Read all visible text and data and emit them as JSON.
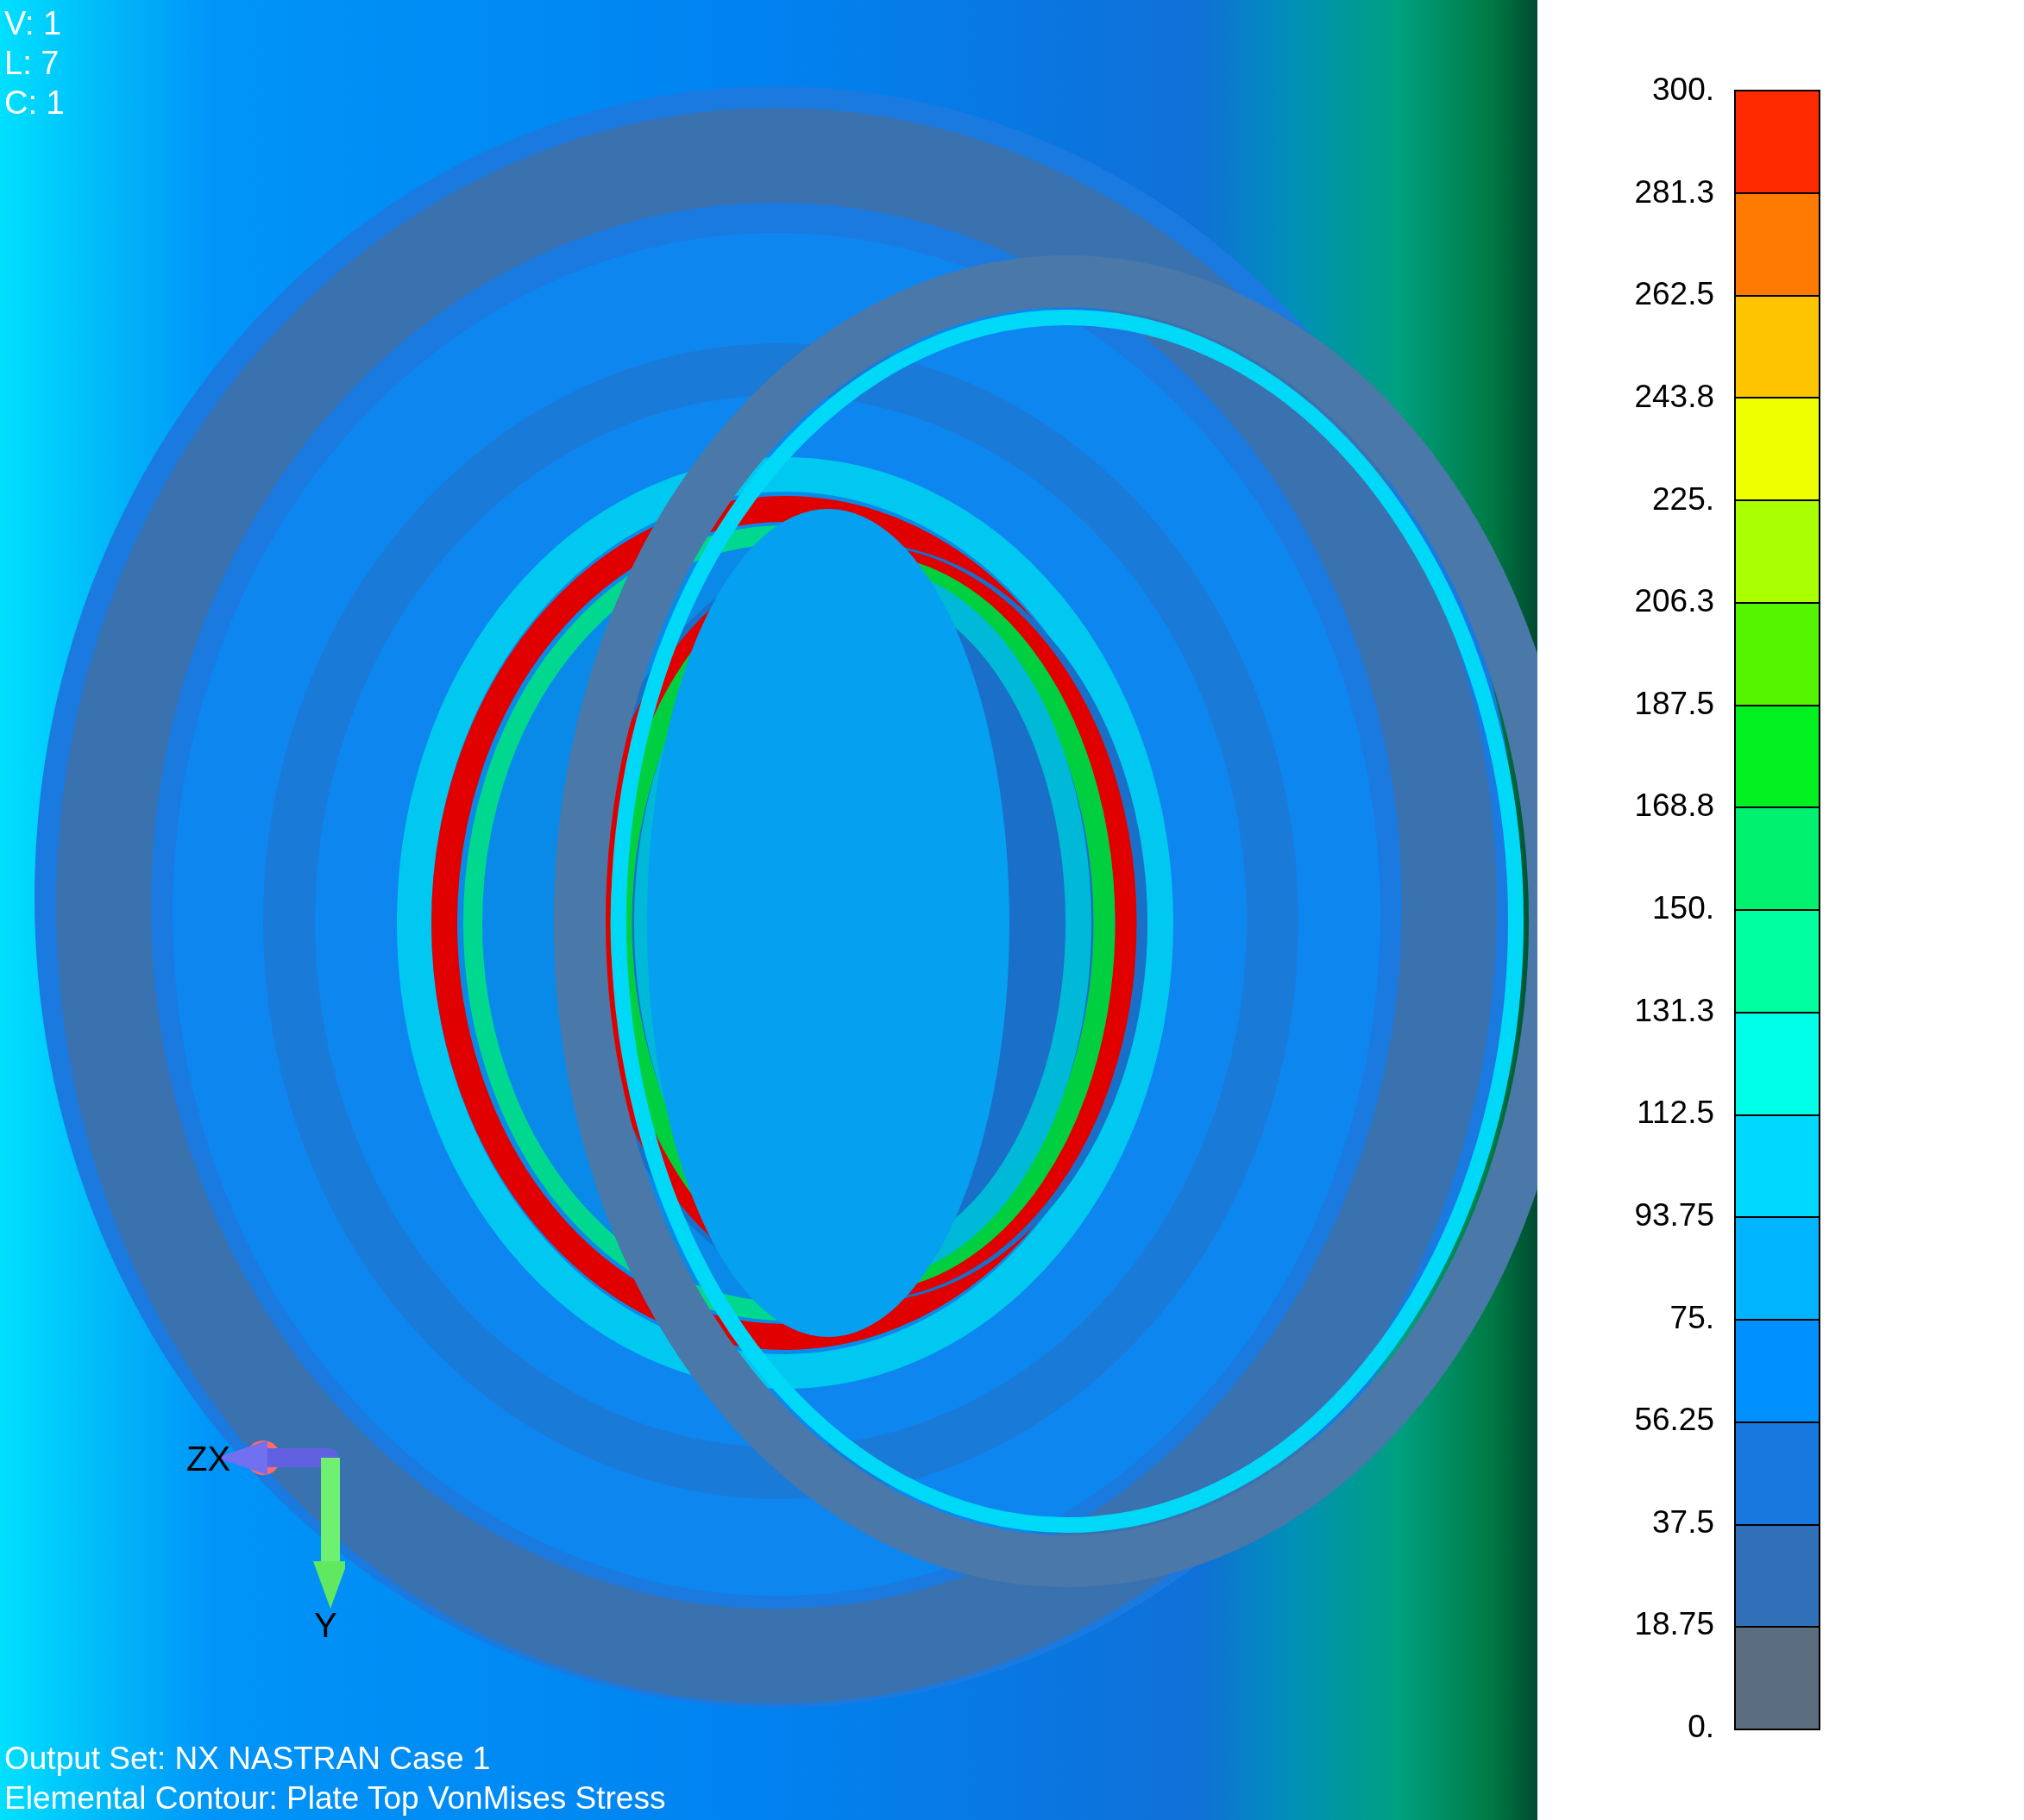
{
  "viewport": {
    "info_lines": [
      "V: 1",
      "L: 7",
      "C: 1"
    ],
    "axis_labels": {
      "horizontal": "ZX",
      "vertical": "Y"
    },
    "footer_lines": [
      "Output Set: NX NASTRAN Case 1",
      "Elemental Contour: Plate Top VonMises Stress"
    ]
  },
  "legend": {
    "labels": [
      "300.",
      "281.3",
      "262.5",
      "243.8",
      "225.",
      "206.3",
      "187.5",
      "168.8",
      "150.",
      "131.3",
      "112.5",
      "93.75",
      "75.",
      "56.25",
      "37.5",
      "18.75",
      "0."
    ],
    "bands": [
      {
        "color": "#ff2a00"
      },
      {
        "color": "#ff7a00"
      },
      {
        "color": "#ffc400"
      },
      {
        "color": "#eeff00"
      },
      {
        "color": "#aaff00"
      },
      {
        "color": "#55f500"
      },
      {
        "color": "#00f020"
      },
      {
        "color": "#00f070"
      },
      {
        "color": "#00ffa0"
      },
      {
        "color": "#00ffe8"
      },
      {
        "color": "#00d8ff"
      },
      {
        "color": "#00b4ff"
      },
      {
        "color": "#0090ff"
      },
      {
        "color": "#1878e0"
      },
      {
        "color": "#3070b8"
      },
      {
        "color": "#5a6e80"
      }
    ]
  }
}
